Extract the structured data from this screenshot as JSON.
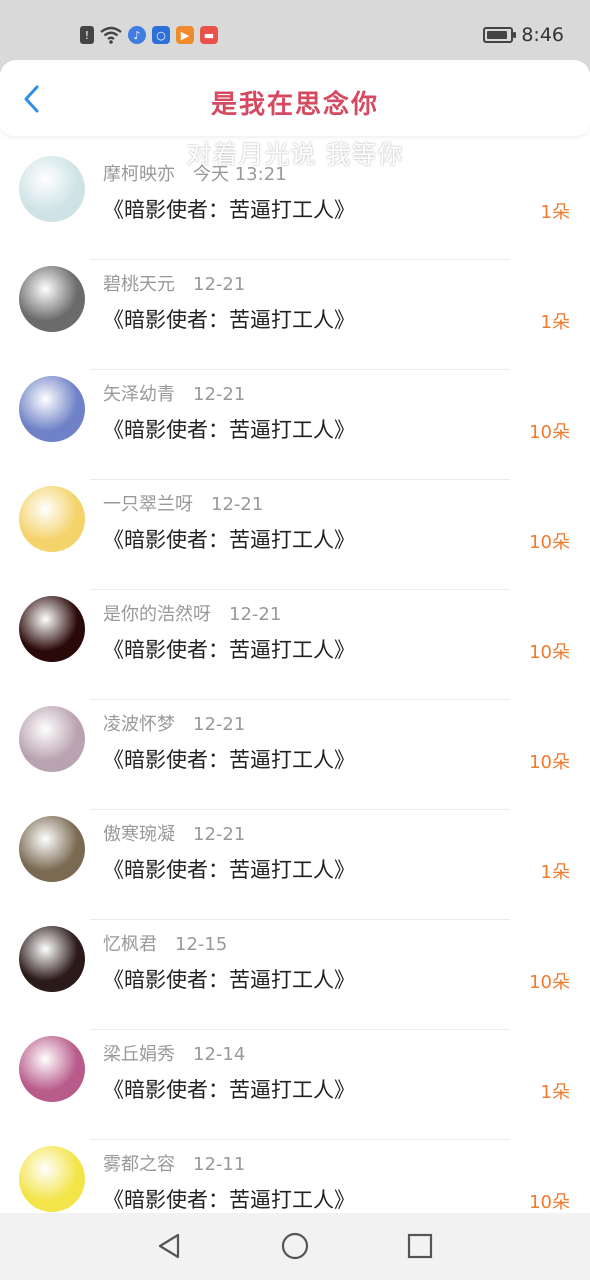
{
  "status_bar": {
    "time": "8:46",
    "battery_level": 0.9,
    "icons": [
      "alert-icon",
      "wifi-icon",
      "music-app-icon",
      "bulb-app-icon",
      "video-app-icon",
      "red-app-icon"
    ]
  },
  "header": {
    "title": "是我在思念你",
    "subtitle": "对着月光说 我等你"
  },
  "colors": {
    "title": "#d64a61",
    "amount": "#f07a2e",
    "back_arrow": "#2f8fe6"
  },
  "items": [
    {
      "name": "摩柯映亦",
      "date": "今天 13:21",
      "book": "《暗影使者：苦逼打工人》",
      "amount": "1朵"
    },
    {
      "name": "碧桃天元",
      "date": "12-21",
      "book": "《暗影使者：苦逼打工人》",
      "amount": "1朵"
    },
    {
      "name": "矢泽幼青",
      "date": "12-21",
      "book": "《暗影使者：苦逼打工人》",
      "amount": "10朵"
    },
    {
      "name": "一只翠兰呀",
      "date": "12-21",
      "book": "《暗影使者：苦逼打工人》",
      "amount": "10朵"
    },
    {
      "name": "是你的浩然呀",
      "date": "12-21",
      "book": "《暗影使者：苦逼打工人》",
      "amount": "10朵"
    },
    {
      "name": "凌波怀梦",
      "date": "12-21",
      "book": "《暗影使者：苦逼打工人》",
      "amount": "10朵"
    },
    {
      "name": "傲寒琬凝",
      "date": "12-21",
      "book": "《暗影使者：苦逼打工人》",
      "amount": "1朵"
    },
    {
      "name": "忆枫君",
      "date": "12-15",
      "book": "《暗影使者：苦逼打工人》",
      "amount": "10朵"
    },
    {
      "name": "梁丘娟秀",
      "date": "12-14",
      "book": "《暗影使者：苦逼打工人》",
      "amount": "1朵"
    },
    {
      "name": "雾都之容",
      "date": "12-11",
      "book": "《暗影使者：苦逼打工人》",
      "amount": "10朵"
    }
  ],
  "avatar_colors": [
    "#cfe3e6",
    "#6b6b6b",
    "#6f82c7",
    "#f4d36a",
    "#2a0a08",
    "#b9a3b0",
    "#7a6a52",
    "#2b1a1a",
    "#b85b8a",
    "#f3e44a"
  ],
  "nav": [
    "back-nav-icon",
    "home-nav-icon",
    "recents-nav-icon"
  ]
}
